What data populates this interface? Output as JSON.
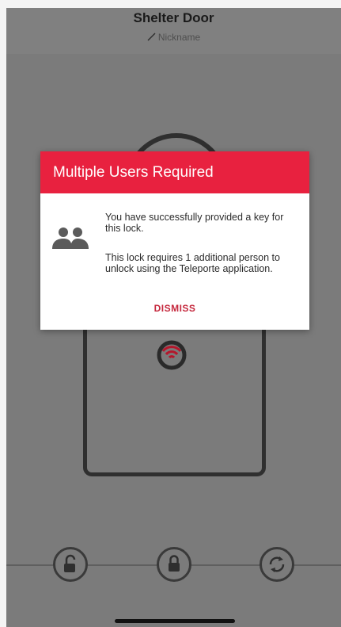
{
  "header": {
    "title": "Shelter Door",
    "nickname_label": "Nickname"
  },
  "dialog": {
    "title": "Multiple Users Required",
    "message_1": "You have successfully provided a key for this lock.",
    "message_2": "This lock requires 1 additional person to unlock using the Teleporte application.",
    "dismiss_label": "DISMISS",
    "icon": "users-icon"
  },
  "controls": {
    "unlock_icon": "unlock-icon",
    "lock_icon": "lock-icon",
    "sync_icon": "sync-icon"
  },
  "colors": {
    "accent_red": "#e8213f",
    "overlay_gray": "#7b7b7b",
    "dismiss_red": "#c5283d"
  }
}
